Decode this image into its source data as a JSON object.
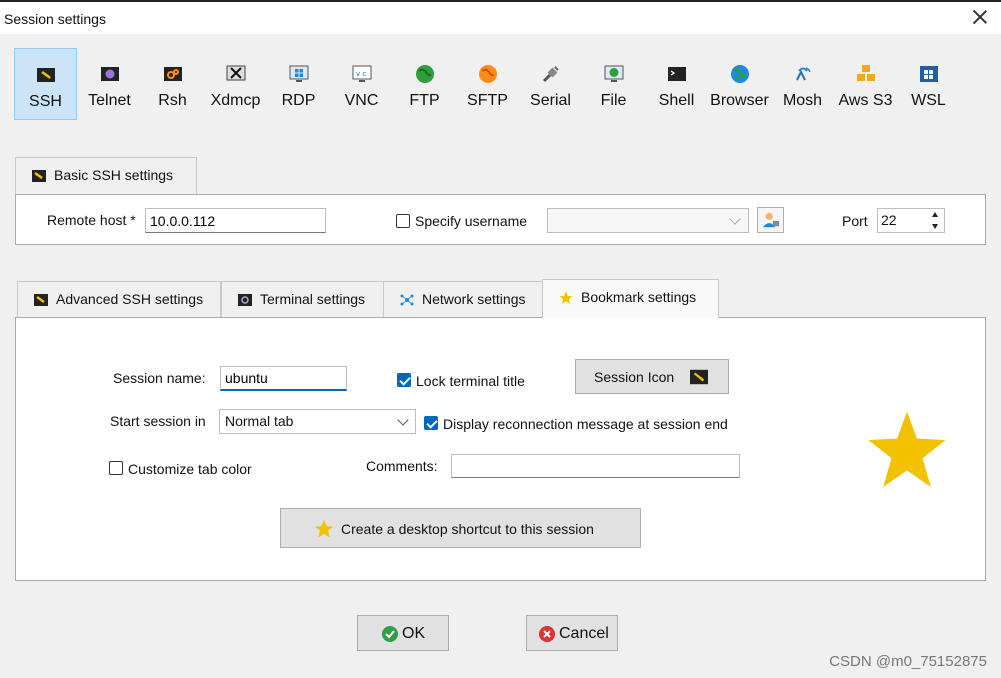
{
  "window": {
    "title": "Session settings"
  },
  "session_types": [
    {
      "label": "SSH",
      "icon": "ssh-key-icon"
    },
    {
      "label": "Telnet",
      "icon": "telnet-icon"
    },
    {
      "label": "Rsh",
      "icon": "rsh-icon"
    },
    {
      "label": "Xdmcp",
      "icon": "xdmcp-icon"
    },
    {
      "label": "RDP",
      "icon": "rdp-icon"
    },
    {
      "label": "VNC",
      "icon": "vnc-icon"
    },
    {
      "label": "FTP",
      "icon": "ftp-globe-icon"
    },
    {
      "label": "SFTP",
      "icon": "sftp-globe-icon"
    },
    {
      "label": "Serial",
      "icon": "serial-plug-icon"
    },
    {
      "label": "File",
      "icon": "file-icon"
    },
    {
      "label": "Shell",
      "icon": "shell-terminal-icon"
    },
    {
      "label": "Browser",
      "icon": "browser-globe-icon"
    },
    {
      "label": "Mosh",
      "icon": "mosh-antenna-icon"
    },
    {
      "label": "Aws S3",
      "icon": "aws-s3-cubes-icon"
    },
    {
      "label": "WSL",
      "icon": "wsl-windows-icon"
    }
  ],
  "active_type": "SSH",
  "basic": {
    "tab_label": "Basic SSH settings",
    "remote_host_label": "Remote host *",
    "remote_host_value": "10.0.0.112",
    "specify_username_label": "Specify username",
    "specify_username_checked": false,
    "username_value": "",
    "port_label": "Port",
    "port_value": "22"
  },
  "tabs": [
    {
      "label": "Advanced SSH settings",
      "icon": "key-icon"
    },
    {
      "label": "Terminal settings",
      "icon": "terminal-icon"
    },
    {
      "label": "Network settings",
      "icon": "network-icon"
    },
    {
      "label": "Bookmark settings",
      "icon": "star-icon"
    }
  ],
  "bookmark": {
    "session_name_label": "Session name:",
    "session_name_value": "ubuntu",
    "lock_title_label": "Lock terminal title",
    "lock_title_checked": true,
    "session_icon_label": "Session Icon",
    "start_in_label": "Start session in",
    "start_in_value": "Normal tab",
    "reconnect_label": "Display reconnection message at session end",
    "reconnect_checked": true,
    "customize_color_label": "Customize tab color",
    "customize_color_checked": false,
    "comments_label": "Comments:",
    "comments_value": "",
    "shortcut_label": "Create a desktop shortcut to this session"
  },
  "footer": {
    "ok_label": "OK",
    "cancel_label": "Cancel"
  },
  "watermark": "CSDN @m0_75152875",
  "colors": {
    "accent": "#0067c0",
    "star": "#f2c200",
    "ok": "#2ea043",
    "cancel": "#d33"
  }
}
